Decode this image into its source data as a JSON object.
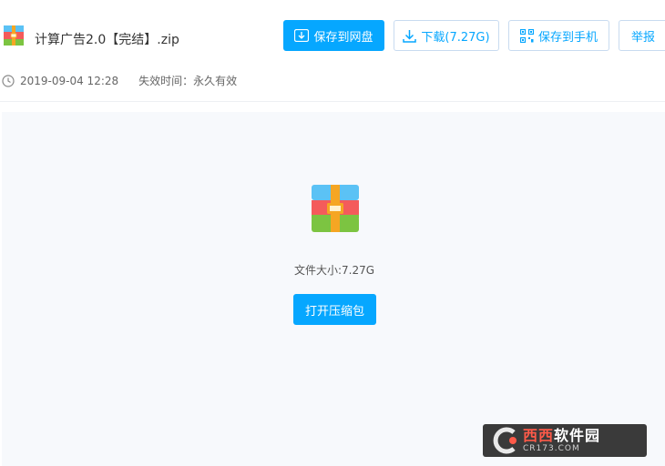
{
  "file": {
    "name": "计算广告2.0【完结】.zip",
    "upload_time": "2019-09-04 12:28",
    "expiry": "失效时间：永久有效",
    "size_text": "文件大小:7.27G"
  },
  "toolbar": {
    "save_label": "保存到网盘",
    "download_label": "下载(7.27G)",
    "phone_label": "保存到手机",
    "report_label": "举报"
  },
  "preview": {
    "open_label": "打开压缩包"
  },
  "watermark": {
    "logo_text_red": "西西",
    "logo_text_white": "软件园",
    "logo_sub": "CR173.COM"
  },
  "colors": {
    "accent": "#06a7ff",
    "preview_bg": "#f7f9fc"
  }
}
